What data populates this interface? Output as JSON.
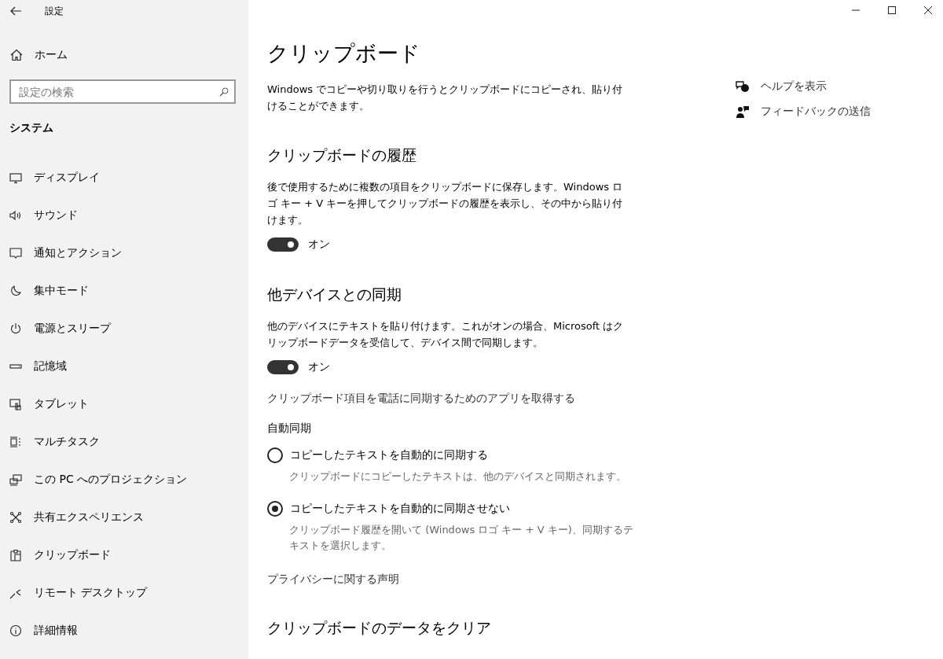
{
  "window": {
    "title": "設定"
  },
  "sidebar": {
    "home": "ホーム",
    "search": {
      "placeholder": "設定の検索"
    },
    "section": "システム",
    "items": [
      {
        "label": "ディスプレイ",
        "selected": false
      },
      {
        "label": "サウンド",
        "selected": false
      },
      {
        "label": "通知とアクション",
        "selected": false
      },
      {
        "label": "集中モード",
        "selected": false
      },
      {
        "label": "電源とスリープ",
        "selected": false
      },
      {
        "label": "記憶域",
        "selected": false
      },
      {
        "label": "タブレット",
        "selected": false
      },
      {
        "label": "マルチタスク",
        "selected": false
      },
      {
        "label": "この PC へのプロジェクション",
        "selected": false
      },
      {
        "label": "共有エクスペリエンス",
        "selected": false
      },
      {
        "label": "クリップボード",
        "selected": false
      },
      {
        "label": "リモート デスクトップ",
        "selected": false
      },
      {
        "label": "詳細情報",
        "selected": false
      }
    ]
  },
  "page": {
    "title": "クリップボード",
    "blocks": [
      {
        "kind": "paragraph",
        "text": "Windows でコピーや切り取りを行うとクリップボードにコピーされ、貼り付けることができます。"
      },
      {
        "kind": "heading",
        "text": "クリップボードの履歴"
      },
      {
        "kind": "paragraph",
        "text": "後で使用するために複数の項目をクリップボードに保存します。Windows ロゴ キー + V キーを押してクリップボードの履歴を表示し、その中から貼り付けます。"
      },
      {
        "kind": "toggle",
        "on": true,
        "text": "オン"
      },
      {
        "kind": "heading",
        "text": "他デバイスとの同期"
      },
      {
        "kind": "paragraph",
        "text": "他のデバイスにテキストを貼り付けます。これがオンの場合、Microsoft はクリップボードデータを受信して、デバイス間で同期します。"
      },
      {
        "kind": "toggle",
        "on": true,
        "text": "オン"
      },
      {
        "kind": "link",
        "text": "クリップボード項目を電話に同期するためのアプリを取得する"
      },
      {
        "kind": "label",
        "text": "自動同期"
      },
      {
        "kind": "radio",
        "selected": false,
        "text": "コピーしたテキストを自動的に同期する",
        "description": "クリップボードにコピーしたテキストは、他のデバイスと同期されます。"
      },
      {
        "kind": "radio",
        "selected": true,
        "text": "コピーしたテキストを自動的に同期させない",
        "description": "クリップボード履歴を開いて (Windows ロゴ キー + V キー)、同期するテキストを選択します。"
      },
      {
        "kind": "link",
        "text": "プライバシーに関する声明"
      },
      {
        "kind": "heading",
        "text": "クリップボードのデータをクリア"
      }
    ]
  },
  "help_links": [
    {
      "text": "ヘルプを表示"
    },
    {
      "text": "フィードバックの送信"
    }
  ]
}
